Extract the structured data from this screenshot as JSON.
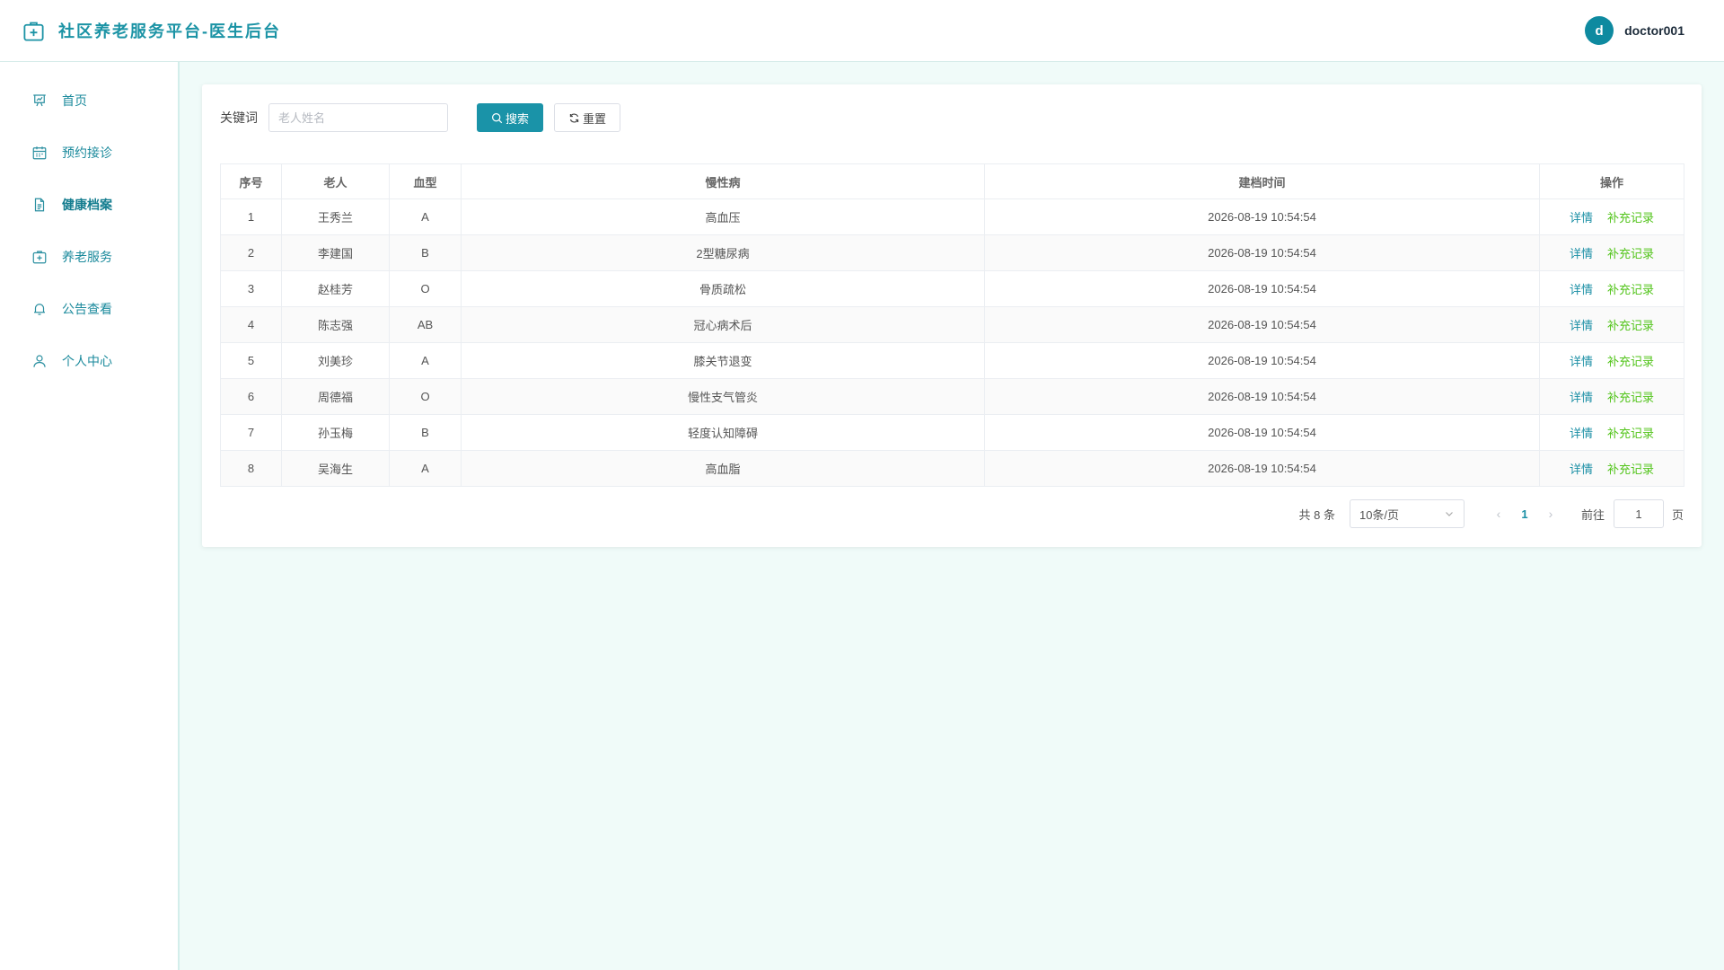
{
  "header": {
    "title": "社区养老服务平台-医生后台",
    "avatar_letter": "d",
    "username": "doctor001"
  },
  "sidebar": {
    "items": [
      {
        "label": "首页",
        "icon": "chart-board-icon",
        "active": false
      },
      {
        "label": "预约接诊",
        "icon": "calendar-icon",
        "active": false
      },
      {
        "label": "健康档案",
        "icon": "document-icon",
        "active": true
      },
      {
        "label": "养老服务",
        "icon": "medical-kit-icon",
        "active": false
      },
      {
        "label": "公告查看",
        "icon": "bell-icon",
        "active": false
      },
      {
        "label": "个人中心",
        "icon": "user-icon",
        "active": false
      }
    ]
  },
  "filter": {
    "label": "关键词",
    "placeholder": "老人姓名",
    "value": "",
    "search_label": "搜索",
    "reset_label": "重置"
  },
  "table": {
    "columns": [
      "序号",
      "老人",
      "血型",
      "慢性病",
      "建档时间",
      "操作"
    ],
    "rows": [
      {
        "index": "1",
        "name": "王秀兰",
        "blood": "A",
        "disease": "高血压",
        "created": "2026-08-19 10:54:54"
      },
      {
        "index": "2",
        "name": "李建国",
        "blood": "B",
        "disease": "2型糖尿病",
        "created": "2026-08-19 10:54:54"
      },
      {
        "index": "3",
        "name": "赵桂芳",
        "blood": "O",
        "disease": "骨质疏松",
        "created": "2026-08-19 10:54:54"
      },
      {
        "index": "4",
        "name": "陈志强",
        "blood": "AB",
        "disease": "冠心病术后",
        "created": "2026-08-19 10:54:54"
      },
      {
        "index": "5",
        "name": "刘美珍",
        "blood": "A",
        "disease": "膝关节退变",
        "created": "2026-08-19 10:54:54"
      },
      {
        "index": "6",
        "name": "周德福",
        "blood": "O",
        "disease": "慢性支气管炎",
        "created": "2026-08-19 10:54:54"
      },
      {
        "index": "7",
        "name": "孙玉梅",
        "blood": "B",
        "disease": "轻度认知障碍",
        "created": "2026-08-19 10:54:54"
      },
      {
        "index": "8",
        "name": "吴海生",
        "blood": "A",
        "disease": "高血脂",
        "created": "2026-08-19 10:54:54"
      }
    ],
    "actions": {
      "detail": "详情",
      "supplement": "补充记录"
    }
  },
  "pagination": {
    "total_text": "共 8 条",
    "page_size": "10条/页",
    "current_page": "1",
    "goto_label": "前往",
    "jump_value": "1",
    "page_suffix": "页"
  },
  "colors": {
    "primary": "#1a93a8",
    "success": "#52c41a",
    "background": "#f0fbf9"
  }
}
